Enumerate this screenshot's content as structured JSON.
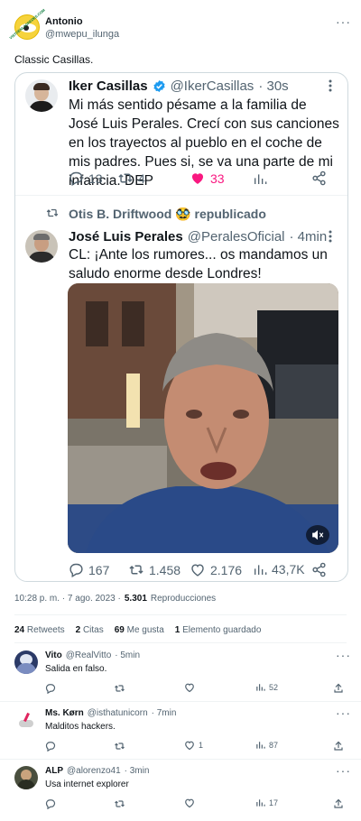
{
  "author": {
    "name": "Antonio",
    "handle": "@mwepu_ilunga",
    "avatar_badge": "VISTOENLASREDES.COM"
  },
  "tweet_text": "Classic Casillas.",
  "quoted": {
    "name": "Iker Casillas",
    "handle": "@IkerCasillas",
    "time": "· 30s",
    "text": "Mi más sentido pésame a la familia de José Luis Perales. Crecí con sus canciones en los trayectos al pueblo en el coche de mis padres. Pues si, se va una parte de mi infancia. DEP",
    "replies": "13",
    "retweets": "4",
    "likes": "33",
    "like_color": "#f91880"
  },
  "retweeted_by": "Otis B. Driftwood 🥸 republicado",
  "inner": {
    "name": "José Luis Perales",
    "handle": "@PeralesOficial",
    "time": "· 4min",
    "text": "CL: ¡Ante los rumores... os mandamos un saludo enorme desde Londres!",
    "replies": "167",
    "retweets": "1.458",
    "likes": "2.176",
    "views": "43,7K"
  },
  "meta": {
    "timestamp": "10:28 p. m. · 7 ago. 2023 ·",
    "views_count": "5.301",
    "views_label": "Reproducciones"
  },
  "counts": {
    "retweets_num": "24",
    "retweets_label": "Retweets",
    "quotes_num": "2",
    "quotes_label": "Citas",
    "likes_num": "69",
    "likes_label": "Me gusta",
    "bookmarks_num": "1",
    "bookmarks_label": "Elemento guardado"
  },
  "replies": [
    {
      "name": "Vito",
      "handle": "@RealVitto",
      "time": "· 5min",
      "text": "Salida en falso.",
      "likes": "",
      "views": "52"
    },
    {
      "name": "Ms. Kørn",
      "handle": "@isthatunicorn",
      "time": "· 7min",
      "text": "Malditos hackers.",
      "likes": "1",
      "views": "87"
    },
    {
      "name": "ALP",
      "handle": "@alorenzo41",
      "time": "· 3min",
      "text": "Usa internet explorer",
      "likes": "",
      "views": "17"
    }
  ],
  "icons": {
    "verified": "verified-badge-icon",
    "mute": "speaker-mute-icon",
    "more": "more-dots-icon"
  },
  "colors": {
    "verified": "#1d9bf0",
    "border": "#cfd9de"
  }
}
